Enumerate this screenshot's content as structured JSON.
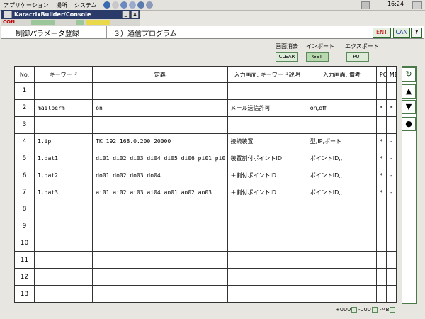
{
  "taskbar": {
    "menus": [
      "アプリケーション",
      "場所",
      "システム"
    ],
    "clock": "16:24"
  },
  "window": {
    "title": "KaracrixBuilder/Console",
    "min_label": "_",
    "close_label": "x",
    "con_label": "CON"
  },
  "header": {
    "title": "制御パラメータ登録",
    "subtitle": "３）通信プログラム",
    "ent_label": "ENT",
    "can_label": "CAN",
    "help_label": "?"
  },
  "actions": {
    "clear_caption": "画面消去",
    "clear_label": "CLEAR",
    "import_caption": "インポート",
    "import_label": "GET",
    "export_caption": "エクスポート",
    "export_label": "PUT"
  },
  "table": {
    "columns": [
      "No.",
      "キーワード",
      "定義",
      "入力画面: キーワード説明",
      "入力画面: 備考",
      "PC",
      "MB"
    ],
    "rows": [
      {
        "no": "1",
        "keyword": "",
        "definition": "",
        "description": "",
        "remark": "",
        "pc": "",
        "mb": ""
      },
      {
        "no": "2",
        "keyword": "mailperm",
        "definition": "on",
        "description": "メール送信許可",
        "remark": "on,off",
        "pc": "*",
        "mb": "*"
      },
      {
        "no": "3",
        "keyword": "",
        "definition": "",
        "description": "",
        "remark": "",
        "pc": "",
        "mb": ""
      },
      {
        "no": "4",
        "keyword": "1.ip",
        "definition": "TK 192.168.0.200 20000",
        "description": "接続装置",
        "remark": "型,IP,ポート",
        "pc": "*",
        "mb": "-"
      },
      {
        "no": "5",
        "keyword": "1.dat1",
        "definition": "di01 di02 di03 di04 di05 di06 pi01 pi0",
        "description": "装置割付ポイントID",
        "remark": "ポイントID,,",
        "pc": "*",
        "mb": "-"
      },
      {
        "no": "6",
        "keyword": "1.dat2",
        "definition": "do01 do02 do03 do04",
        "description": "＋割付ポイントID",
        "remark": "ポイントID,,",
        "pc": "*",
        "mb": "-"
      },
      {
        "no": "7",
        "keyword": "1.dat3",
        "definition": "ai01 ai02 ai03 ai04 ao01 ao02 ao03",
        "description": "＋割付ポイントID",
        "remark": "ポイントID,,",
        "pc": "*",
        "mb": "-"
      },
      {
        "no": "8",
        "keyword": "",
        "definition": "",
        "description": "",
        "remark": "",
        "pc": "",
        "mb": ""
      },
      {
        "no": "9",
        "keyword": "",
        "definition": "",
        "description": "",
        "remark": "",
        "pc": "",
        "mb": ""
      },
      {
        "no": "10",
        "keyword": "",
        "definition": "",
        "description": "",
        "remark": "",
        "pc": "",
        "mb": ""
      },
      {
        "no": "11",
        "keyword": "",
        "definition": "",
        "description": "",
        "remark": "",
        "pc": "",
        "mb": ""
      },
      {
        "no": "12",
        "keyword": "",
        "definition": "",
        "description": "",
        "remark": "",
        "pc": "",
        "mb": ""
      },
      {
        "no": "13",
        "keyword": "",
        "definition": "",
        "description": "",
        "remark": "",
        "pc": "",
        "mb": ""
      }
    ]
  },
  "sidebar": {
    "refresh_icon": "↻",
    "up_icon": "▲",
    "down_icon": "▼",
    "dot_icon": "●"
  },
  "footer": {
    "plus_label": "+UUU",
    "minus_label": "-UUU",
    "mb_label": "-MB"
  }
}
